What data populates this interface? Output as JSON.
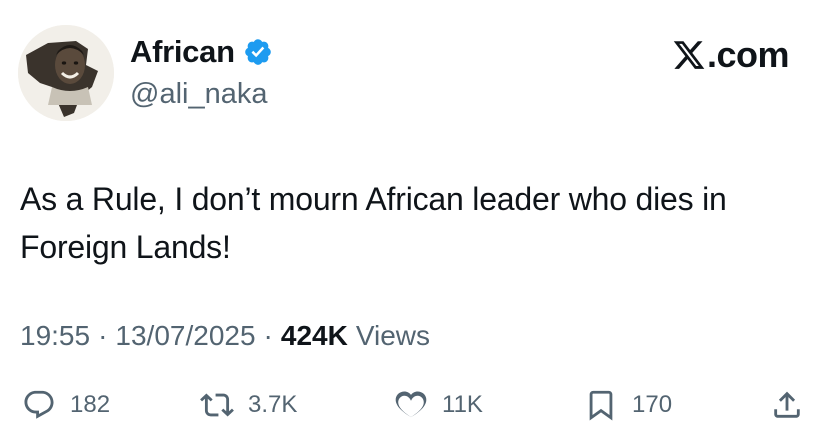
{
  "user": {
    "display_name": "African",
    "handle": "@ali_naka",
    "verified": true,
    "avatar_icon": "profile-photo"
  },
  "brand": {
    "logo_icon": "x-logo-icon",
    "domain": ".com"
  },
  "tweet": {
    "text": "As a Rule, I don’t mourn African leader who dies in Foreign Lands!"
  },
  "meta": {
    "time": "19:55",
    "separator": "·",
    "date": "13/07/2025",
    "views_count": "424K",
    "views_label": "Views"
  },
  "actions": {
    "reply": {
      "icon": "reply-icon",
      "count": "182"
    },
    "repost": {
      "icon": "repost-icon",
      "count": "3.7K"
    },
    "like": {
      "icon": "heart-icon",
      "count": "11K"
    },
    "bookmark": {
      "icon": "bookmark-icon",
      "count": "170"
    },
    "share": {
      "icon": "share-icon"
    }
  },
  "colors": {
    "text_primary": "#0f1419",
    "text_secondary": "#536471",
    "verified_blue": "#1d9bf0"
  }
}
